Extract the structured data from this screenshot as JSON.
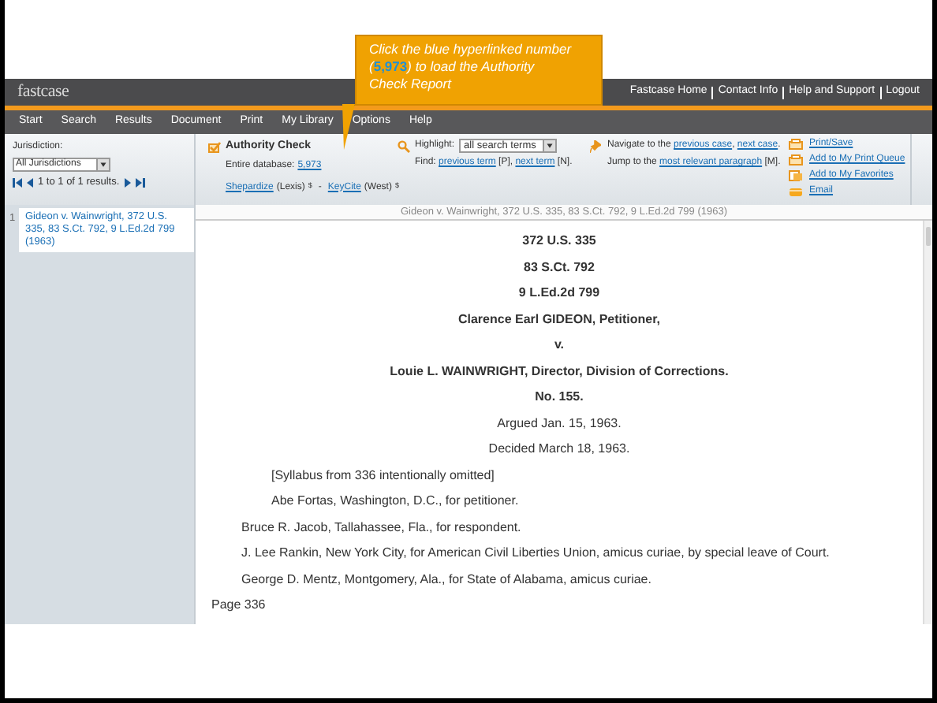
{
  "callout": {
    "parts": [
      {
        "kind": "text",
        "text": "Click the blue hyperlinked number ("
      },
      {
        "kind": "number",
        "text": "5,973"
      },
      {
        "kind": "text",
        "text": ") to load the Authority Check Report"
      }
    ]
  },
  "header": {
    "logo": "fastcase",
    "links": [
      "Fastcase Home",
      "Contact Info",
      "Help and Support",
      "Logout"
    ]
  },
  "menu": [
    "Start",
    "Search",
    "Results",
    "Document",
    "Print",
    "My Library",
    "Options",
    "Help"
  ],
  "jurisdiction": {
    "label": "Jurisdiction:",
    "value": "All Jurisdictions",
    "results": "1 to 1 of 1 results."
  },
  "authority_check": {
    "title": "Authority Check",
    "database_label": "Entire database:",
    "count": "5,973",
    "services": [
      {
        "link": "Shepardize",
        "source": "(Lexis)",
        "fee": "$"
      },
      {
        "link": "KeyCite",
        "source": "(West)",
        "fee": "$"
      }
    ],
    "separator": "-"
  },
  "highlight": {
    "label": "Highlight:",
    "value": "all search terms",
    "find": [
      {
        "kind": "text",
        "text": "Find: "
      },
      {
        "kind": "link",
        "text": "previous term"
      },
      {
        "kind": "text",
        "text": " [P], "
      },
      {
        "kind": "link",
        "text": "next term"
      },
      {
        "kind": "text",
        "text": " [N]."
      }
    ]
  },
  "navigate": [
    [
      {
        "kind": "text",
        "text": "Navigate to the "
      },
      {
        "kind": "link",
        "text": "previous case"
      },
      {
        "kind": "text",
        "text": ", "
      },
      {
        "kind": "link",
        "text": "next case"
      },
      {
        "kind": "text",
        "text": "."
      }
    ],
    [
      {
        "kind": "text",
        "text": "Jump to the "
      },
      {
        "kind": "link",
        "text": "most relevant paragraph"
      },
      {
        "kind": "text",
        "text": " [M]."
      }
    ]
  ],
  "actions": [
    {
      "kind": "print",
      "label": "Print/Save"
    },
    {
      "kind": "queue",
      "label": "Add to My Print Queue"
    },
    {
      "kind": "favorite",
      "label": "Add to My Favorites"
    },
    {
      "kind": "email",
      "label": "Email"
    }
  ],
  "results": [
    {
      "number": "1",
      "title": "Gideon v. Wainwright, 372 U.S. 335, 83 S.Ct. 792, 9 L.Ed.2d 799 (1963)"
    }
  ],
  "document": {
    "title": "Gideon v. Wainwright, 372 U.S. 335, 83 S.Ct. 792, 9 L.Ed.2d 799 (1963)",
    "lines": [
      {
        "kind": "heading",
        "text": "372 U.S. 335"
      },
      {
        "kind": "heading",
        "text": "83 S.Ct. 792"
      },
      {
        "kind": "heading",
        "text": "9 L.Ed.2d 799"
      },
      {
        "kind": "heading",
        "text": "Clarence Earl GIDEON, Petitioner,"
      },
      {
        "kind": "heading",
        "text": "v."
      },
      {
        "kind": "heading",
        "text": "Louie L. WAINWRIGHT, Director, Division of Corrections."
      },
      {
        "kind": "heading",
        "text": "No. 155."
      },
      {
        "kind": "center",
        "text": "Argued Jan. 15, 1963."
      },
      {
        "kind": "center",
        "text": "Decided March 18, 1963."
      },
      {
        "kind": "indent2",
        "text": "[Syllabus from 336 intentionally omitted]"
      },
      {
        "kind": "indent2",
        "text": "Abe Fortas, Washington, D.C., for petitioner."
      },
      {
        "kind": "indent1",
        "text": "Bruce R. Jacob, Tallahassee, Fla., for respondent."
      },
      {
        "kind": "indent1",
        "text": "J. Lee Rankin, New York City, for American Civil Liberties Union, amicus curiae, by special leave of Court."
      },
      {
        "kind": "indent1",
        "text": "George D. Mentz, Montgomery, Ala., for State of Alabama, amicus curiae."
      },
      {
        "kind": "page",
        "text": "Page 336"
      }
    ]
  }
}
